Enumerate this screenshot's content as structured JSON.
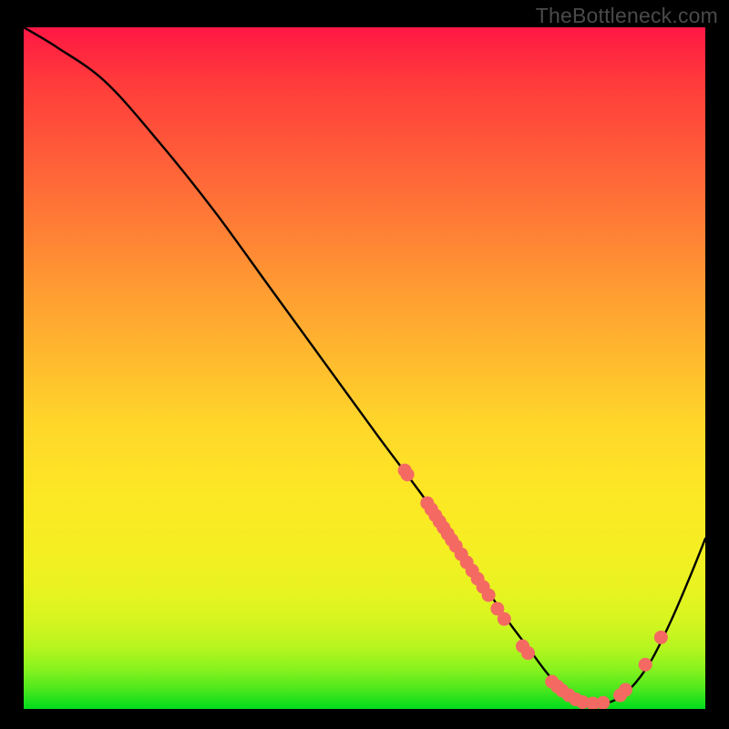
{
  "watermark": "TheBottleneck.com",
  "colors": {
    "background": "#000000",
    "curve_stroke": "#000000",
    "dot_fill": "#f46a62",
    "watermark_text": "#4a4a4a"
  },
  "chart_data": {
    "type": "line",
    "title": "",
    "xlabel": "",
    "ylabel": "",
    "xlim": [
      0,
      100
    ],
    "ylim": [
      0,
      100
    ],
    "grid": false,
    "legend": false,
    "series": [
      {
        "name": "bottleneck-curve",
        "x": [
          0,
          5,
          12,
          20,
          28,
          36,
          44,
          52,
          58,
          63,
          67,
          71,
          74,
          77,
          80,
          83,
          86,
          89,
          92,
          95,
          98,
          100
        ],
        "y": [
          100,
          97,
          92,
          83,
          73,
          62,
          51,
          40,
          32,
          25,
          19,
          13,
          9,
          5,
          2,
          1,
          1,
          3,
          7,
          13,
          20,
          25
        ]
      }
    ],
    "scatter_points": [
      {
        "x": 55.9,
        "y": 35.0
      },
      {
        "x": 56.3,
        "y": 34.4
      },
      {
        "x": 59.2,
        "y": 30.2
      },
      {
        "x": 59.8,
        "y": 29.3
      },
      {
        "x": 60.4,
        "y": 28.4
      },
      {
        "x": 61.0,
        "y": 27.5
      },
      {
        "x": 61.6,
        "y": 26.6
      },
      {
        "x": 62.2,
        "y": 25.7
      },
      {
        "x": 62.8,
        "y": 24.8
      },
      {
        "x": 63.4,
        "y": 23.9
      },
      {
        "x": 64.2,
        "y": 22.7
      },
      {
        "x": 65.0,
        "y": 21.5
      },
      {
        "x": 65.8,
        "y": 20.3
      },
      {
        "x": 66.6,
        "y": 19.1
      },
      {
        "x": 67.4,
        "y": 17.9
      },
      {
        "x": 68.2,
        "y": 16.7
      },
      {
        "x": 69.5,
        "y": 14.7
      },
      {
        "x": 70.5,
        "y": 13.2
      },
      {
        "x": 73.2,
        "y": 9.2
      },
      {
        "x": 74.0,
        "y": 8.2
      },
      {
        "x": 77.5,
        "y": 4.0
      },
      {
        "x": 78.3,
        "y": 3.3
      },
      {
        "x": 79.0,
        "y": 2.7
      },
      {
        "x": 80.0,
        "y": 2.0
      },
      {
        "x": 81.0,
        "y": 1.4
      },
      {
        "x": 82.0,
        "y": 1.0
      },
      {
        "x": 83.5,
        "y": 0.8
      },
      {
        "x": 85.0,
        "y": 0.9
      },
      {
        "x": 87.5,
        "y": 2.0
      },
      {
        "x": 88.3,
        "y": 2.8
      },
      {
        "x": 91.2,
        "y": 6.5
      },
      {
        "x": 93.5,
        "y": 10.5
      }
    ]
  }
}
